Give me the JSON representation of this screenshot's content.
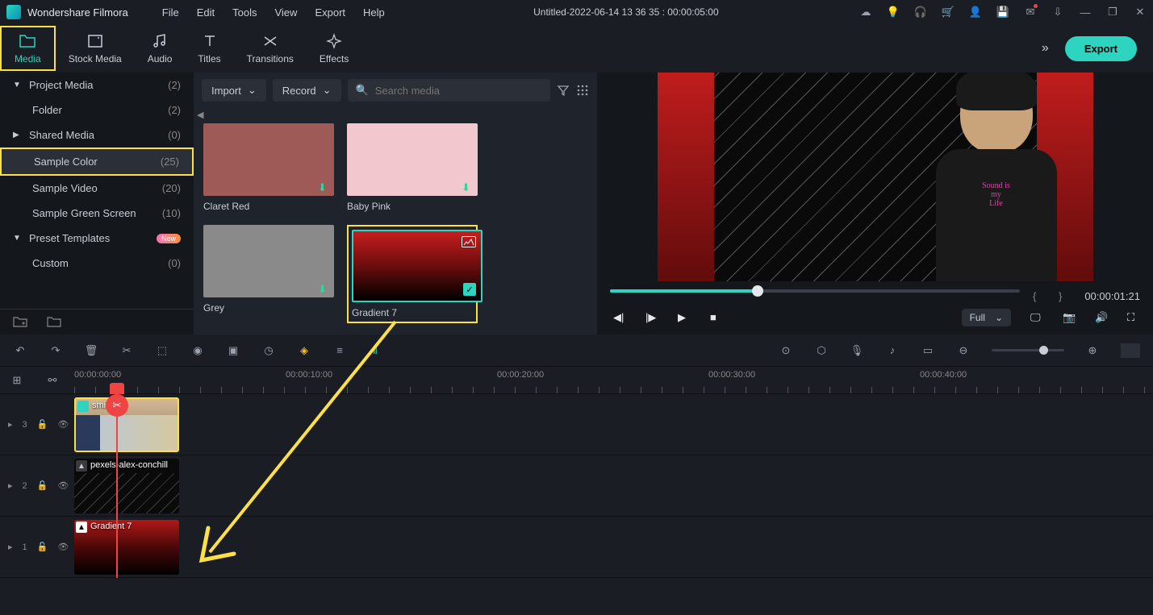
{
  "app": {
    "name": "Wondershare Filmora"
  },
  "menu": [
    "File",
    "Edit",
    "Tools",
    "View",
    "Export",
    "Help"
  ],
  "title_center": "Untitled-2022-06-14 13 36 35 : 00:00:05:00",
  "tabs": [
    {
      "label": "Media",
      "icon": "folder"
    },
    {
      "label": "Stock Media",
      "icon": "film"
    },
    {
      "label": "Audio",
      "icon": "music"
    },
    {
      "label": "Titles",
      "icon": "text"
    },
    {
      "label": "Transitions",
      "icon": "transition"
    },
    {
      "label": "Effects",
      "icon": "sparkle"
    }
  ],
  "export_label": "Export",
  "sidebar": {
    "items": [
      {
        "label": "Project Media",
        "count": "(2)",
        "arrow": "▼",
        "nested": false
      },
      {
        "label": "Folder",
        "count": "(2)",
        "nested": true
      },
      {
        "label": "Shared Media",
        "count": "(0)",
        "arrow": "▶",
        "nested": false
      },
      {
        "label": "Sample Color",
        "count": "(25)",
        "nested": true,
        "selected": true,
        "highlight": true
      },
      {
        "label": "Sample Video",
        "count": "(20)",
        "nested": true
      },
      {
        "label": "Sample Green Screen",
        "count": "(10)",
        "nested": true
      },
      {
        "label": "Preset Templates",
        "count": "",
        "arrow": "▼",
        "nested": false,
        "new": true
      },
      {
        "label": "Custom",
        "count": "(0)",
        "nested": true
      }
    ]
  },
  "toolbar": {
    "import_label": "Import",
    "record_label": "Record",
    "search_placeholder": "Search media"
  },
  "thumbs": [
    {
      "label": "Claret Red",
      "color": "#9e5a56"
    },
    {
      "label": "Baby Pink",
      "color": "#f2c7cd"
    },
    {
      "label": "Grey",
      "color": "#8a8a8a"
    },
    {
      "label": "Gradient 7",
      "gradient": true,
      "selected": true,
      "highlight": true
    }
  ],
  "preview": {
    "timecode": "00:00:01:21",
    "quality": "Full"
  },
  "ruler": {
    "marks": [
      "00:00:00:00",
      "00:00:10:00",
      "00:00:20:00",
      "00:00:30:00",
      "00:00:40:00"
    ]
  },
  "tracks": {
    "t3_label": "3",
    "t2_label": "2",
    "t1_label": "1",
    "clip_smile": "smile2",
    "clip_pexels": "pexels-alex-conchill",
    "clip_gradient": "Gradient 7"
  }
}
